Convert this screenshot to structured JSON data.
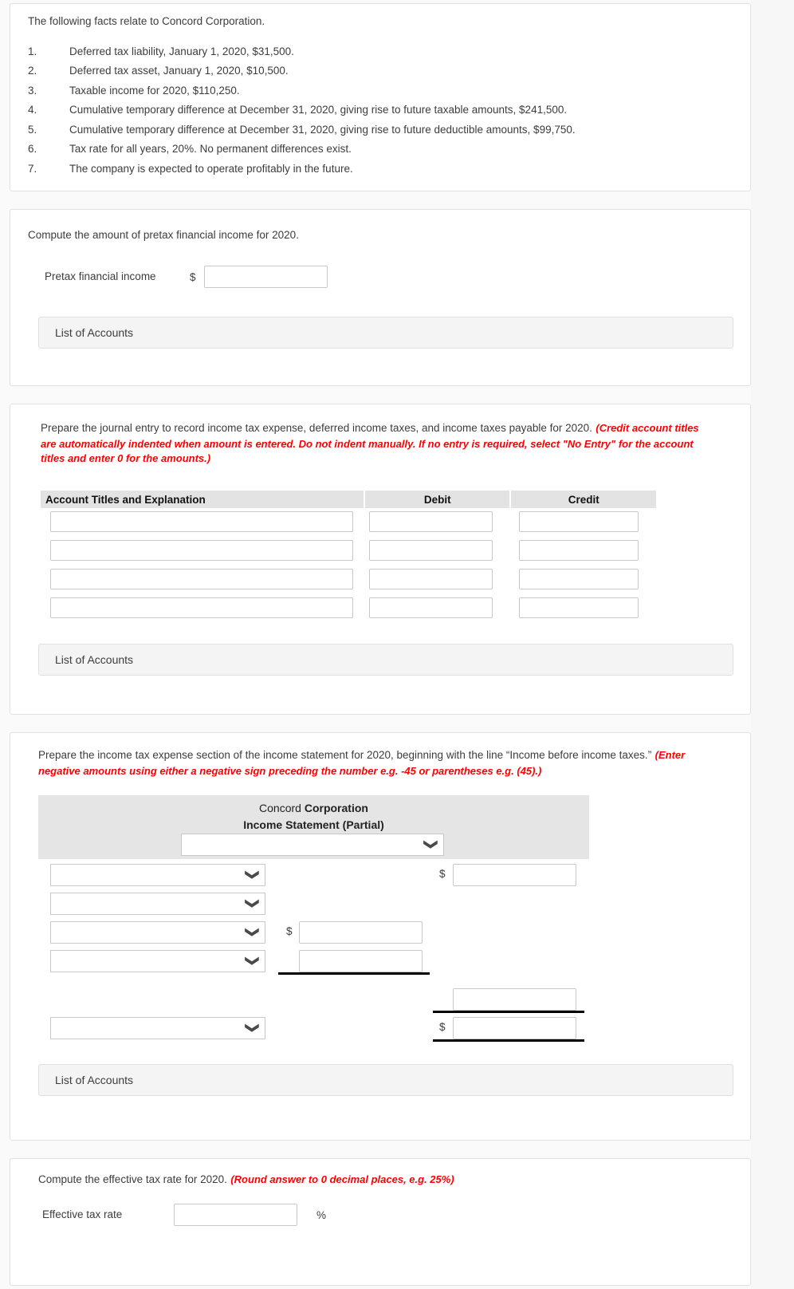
{
  "facts": {
    "intro": "The following facts relate to Concord Corporation.",
    "items": [
      {
        "num": "1.",
        "text": "Deferred tax liability, January 1, 2020, $31,500."
      },
      {
        "num": "2.",
        "text": "Deferred tax asset, January 1, 2020, $10,500."
      },
      {
        "num": "3.",
        "text": "Taxable income for 2020, $110,250."
      },
      {
        "num": "4.",
        "text": "Cumulative temporary difference at December 31, 2020, giving rise to future taxable amounts, $241,500."
      },
      {
        "num": "5.",
        "text": "Cumulative temporary difference at December 31, 2020, giving rise to future deductible amounts, $99,750."
      },
      {
        "num": "6.",
        "text": "Tax rate for all years, 20%. No permanent differences exist."
      },
      {
        "num": "7.",
        "text": "The company is expected to operate profitably in the future."
      }
    ]
  },
  "part_a": {
    "prompt": "Compute the amount of pretax financial income for 2020.",
    "label": "Pretax financial income",
    "currency": "$",
    "value": "",
    "list_of_accounts": "List of Accounts"
  },
  "part_b": {
    "prompt": "Prepare the journal entry to record income tax expense, deferred income taxes, and income taxes payable for 2020.",
    "prompt_red": "(Credit account titles are automatically indented when amount is entered. Do not indent manually. If no entry is required, select \"No Entry\" for the account titles and enter 0 for the amounts.)",
    "headers": [
      "Account Titles and Explanation",
      "Debit",
      "Credit"
    ],
    "rows": [
      {
        "account": "",
        "debit": "",
        "credit": ""
      },
      {
        "account": "",
        "debit": "",
        "credit": ""
      },
      {
        "account": "",
        "debit": "",
        "credit": ""
      },
      {
        "account": "",
        "debit": "",
        "credit": ""
      }
    ],
    "list_of_accounts": "List of Accounts"
  },
  "part_c": {
    "prompt": "Prepare the income tax expense section of the income statement for 2020, beginning with the line “Income before income taxes.”",
    "prompt_red": "(Enter negative amounts using either a negative sign preceding the number e.g. -45 or parentheses e.g. (45).)",
    "company_normal": "Concord ",
    "company_bold": "Corporation",
    "statement_title": "Income Statement (Partial)",
    "header_select": {
      "value": "",
      "icon": "chevron-down-icon"
    },
    "lines": [
      {
        "select": "",
        "mid_currency": "",
        "mid_value": "",
        "right_currency": "$",
        "right_value": ""
      },
      {
        "select": "",
        "mid_currency": "",
        "mid_value": "",
        "right_currency": "",
        "right_value": ""
      },
      {
        "select": "",
        "mid_currency": "$",
        "mid_value": "",
        "right_currency": "",
        "right_value": ""
      },
      {
        "select": "",
        "mid_currency": "",
        "mid_value": "",
        "right_currency": "",
        "right_value": ""
      }
    ],
    "subtotal": {
      "currency": "",
      "value": ""
    },
    "total": {
      "select": "",
      "currency": "$",
      "value": ""
    },
    "list_of_accounts": "List of Accounts"
  },
  "part_d": {
    "prompt": "Compute the effective tax rate for 2020.",
    "prompt_red": "(Round answer to 0 decimal places, e.g. 25%)",
    "label": "Effective tax rate",
    "value": "",
    "unit": "%"
  },
  "icons": {
    "chevron_down": "⌄"
  }
}
